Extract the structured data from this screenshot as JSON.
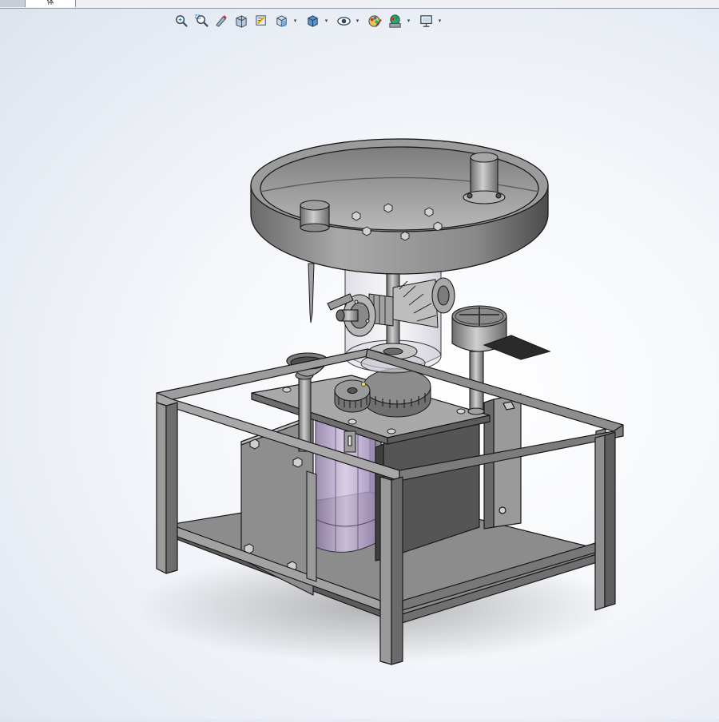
{
  "tabs": [
    {
      "label": ""
    },
    {
      "label": "体"
    }
  ],
  "toolbar": [
    {
      "icon": "zoom-to-fit-icon",
      "dropdown": false
    },
    {
      "icon": "zoom-to-area-icon",
      "dropdown": false
    },
    {
      "icon": "previous-view-icon",
      "dropdown": false
    },
    {
      "icon": "section-view-icon",
      "dropdown": false
    },
    {
      "icon": "dynamic-annotation-icon",
      "dropdown": false
    },
    {
      "icon": "view-orientation-icon",
      "dropdown": true
    },
    {
      "icon": "display-style-icon",
      "dropdown": true
    },
    {
      "icon": "hide-show-items-icon",
      "dropdown": true
    },
    {
      "icon": "edit-appearance-icon",
      "dropdown": false
    },
    {
      "icon": "apply-scene-icon",
      "dropdown": true
    },
    {
      "icon": "view-settings-icon",
      "dropdown": true
    }
  ],
  "colors": {
    "metal_light": "#b4b4b4",
    "metal_mid": "#8e8e8e",
    "metal_dark": "#5e5e5e",
    "edge": "#1a1a1a",
    "transparent_housing": "#d8d4e6",
    "accent_violet": "#a58fbf"
  }
}
